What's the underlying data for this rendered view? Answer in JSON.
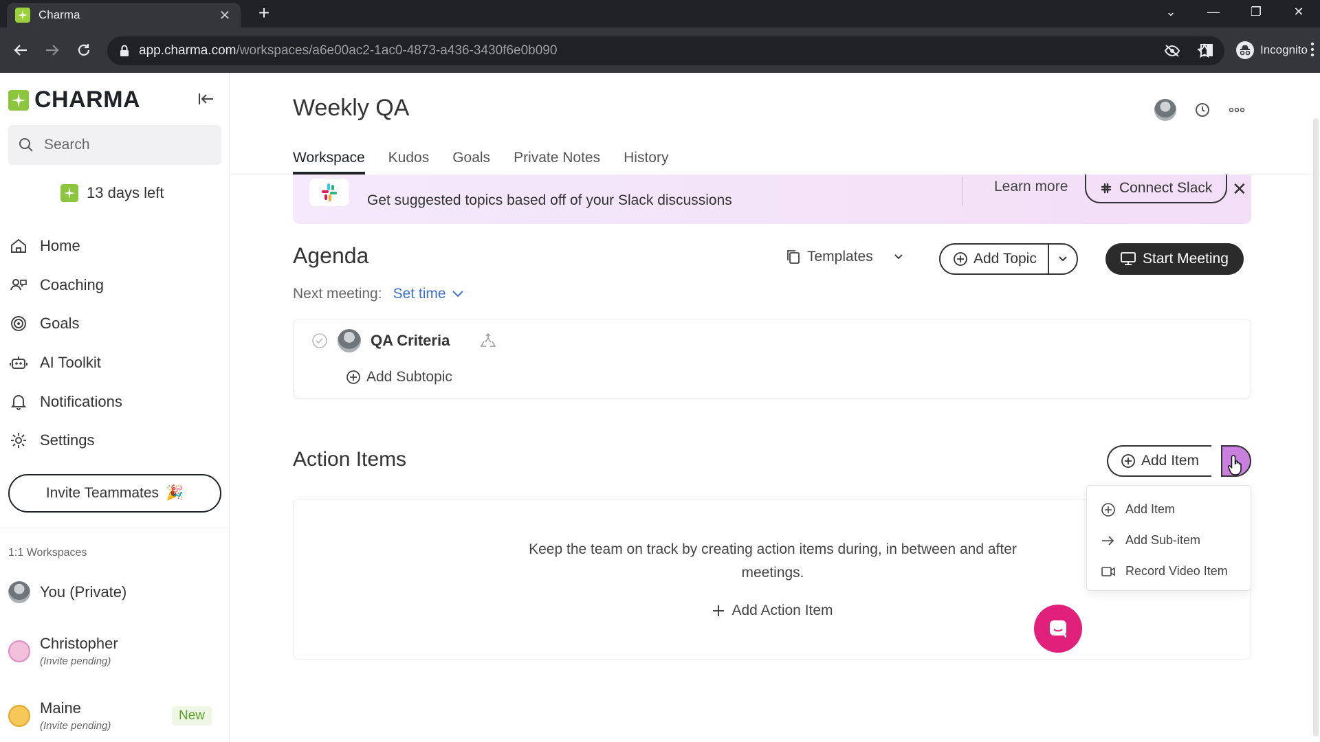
{
  "browser": {
    "tab_title": "Charma",
    "url_host": "app.charma.com",
    "url_path": "/workspaces/a6e00ac2-1ac0-4873-a436-3430f6e0b090",
    "incognito_label": "Incognito"
  },
  "sidebar": {
    "logo": "CHARMA",
    "search_placeholder": "Search",
    "trial": "13 days left",
    "nav": [
      {
        "label": "Home",
        "icon": "home-icon"
      },
      {
        "label": "Coaching",
        "icon": "coaching-icon"
      },
      {
        "label": "Goals",
        "icon": "goals-icon"
      },
      {
        "label": "AI Toolkit",
        "icon": "robot-icon"
      },
      {
        "label": "Notifications",
        "icon": "bell-icon"
      },
      {
        "label": "Settings",
        "icon": "gear-icon"
      }
    ],
    "invite_label": "Invite Teammates",
    "workspaces_heading": "1:1 Workspaces",
    "workspaces": [
      {
        "name": "You (Private)",
        "sub": ""
      },
      {
        "name": "Christopher",
        "sub": "(Invite pending)"
      },
      {
        "name": "Maine",
        "sub": "(Invite pending)",
        "badge": "New"
      }
    ]
  },
  "main": {
    "title": "Weekly QA",
    "tabs": [
      "Workspace",
      "Kudos",
      "Goals",
      "Private Notes",
      "History"
    ],
    "active_tab": "Workspace",
    "banner": {
      "text": "Get suggested topics based off of your Slack discussions",
      "learn_more": "Learn more",
      "connect": "Connect Slack"
    },
    "agenda": {
      "title": "Agenda",
      "templates": "Templates",
      "add_topic": "Add Topic",
      "start_meeting": "Start Meeting",
      "next_meeting_label": "Next meeting:",
      "set_time": "Set time",
      "topic": "QA Criteria",
      "add_subtopic": "Add Subtopic"
    },
    "action_items": {
      "title": "Action Items",
      "add_item": "Add Item",
      "empty_text": "Keep the team on track by creating action items during, in between and after meetings.",
      "add_action": "Add Action Item",
      "menu": [
        "Add Item",
        "Add Sub-item",
        "Record Video Item"
      ]
    }
  },
  "colors": {
    "brand_green": "#8cc63f",
    "banner_bg": "#f3def7",
    "dropdown_accent": "#c87fdd",
    "link_blue": "#3b6fd8",
    "chat_pink": "#e0207a"
  }
}
